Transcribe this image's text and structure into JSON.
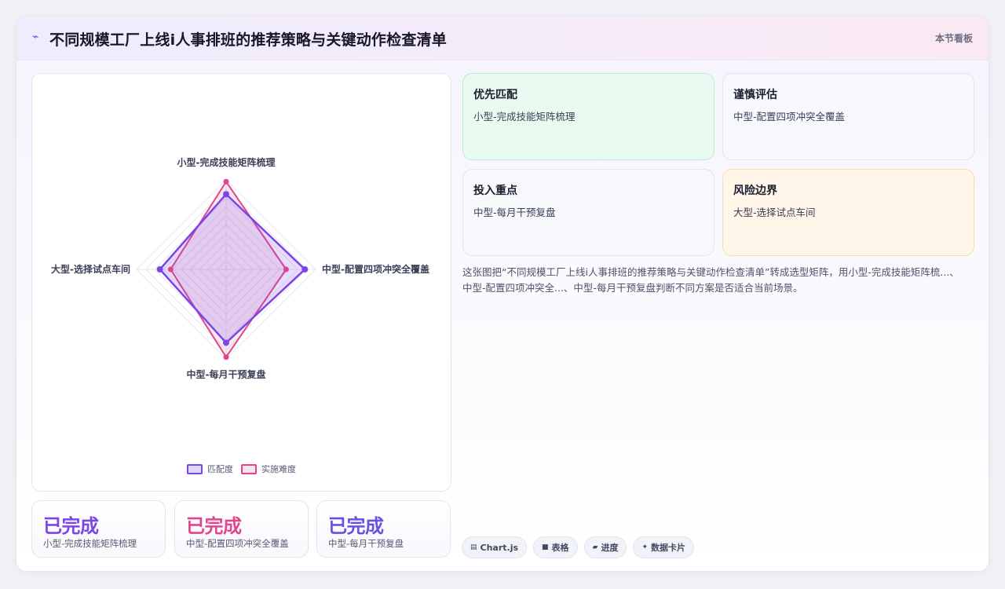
{
  "header": {
    "logo_icon": "sparkline-icon",
    "title": "不同规模工厂上线i人事排班的推荐策略与关键动作检查清单",
    "side_link": "本节看板"
  },
  "chart_data": {
    "type": "radar",
    "categories": [
      "小型-完成技能矩阵梳理",
      "中型-配置四项冲突全覆盖",
      "中型-每月干预复盘",
      "大型-选择试点车间"
    ],
    "series": [
      {
        "name": "匹配度",
        "values": [
          84,
          88,
          82,
          74
        ],
        "color": "#7b45e8"
      },
      {
        "name": "实施难度",
        "values": [
          98,
          67,
          98,
          62
        ],
        "color": "#e0468c"
      }
    ],
    "rlim": [
      0,
      100
    ],
    "grid_rings": 10,
    "legend_position": "bottom"
  },
  "legend": [
    {
      "label": "匹配度"
    },
    {
      "label": "实施难度"
    }
  ],
  "stats": [
    {
      "value": "已完成",
      "label": "小型-完成技能矩阵梳理",
      "color": "#7b45e8"
    },
    {
      "value": "已完成",
      "label": "中型-配置四项冲突全覆盖",
      "color": "#e0468c"
    },
    {
      "value": "已完成",
      "label": "中型-每月干预复盘",
      "color": "#6b4fe0"
    }
  ],
  "recommendations": [
    {
      "title": "优先匹配",
      "text": "小型-完成技能矩阵梳理"
    },
    {
      "title": "谨慎评估",
      "text": "中型-配置四项冲突全覆盖"
    },
    {
      "title": "投入重点",
      "text": "中型-每月干预复盘"
    },
    {
      "title": "风险边界",
      "text": "大型-选择试点车间"
    }
  ],
  "description": "这张图把“不同规模工厂上线i人事排班的推荐策略与关键动作检查清单”转成选型矩阵，用小型-完成技能矩阵梳...、中型-配置四项冲突全...、中型-每月干预复盘判断不同方案是否适合当前场景。",
  "tags": [
    {
      "icon": "chart-icon",
      "glyph": "▤",
      "label": "Chart.js"
    },
    {
      "icon": "table-icon",
      "glyph": "■",
      "label": "表格"
    },
    {
      "icon": "progress-icon",
      "glyph": "▰",
      "label": "进度"
    },
    {
      "icon": "sparkle-icon",
      "glyph": "✦",
      "label": "数据卡片"
    }
  ]
}
